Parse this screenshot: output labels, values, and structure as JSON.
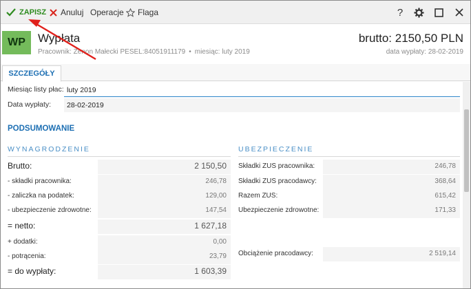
{
  "toolbar": {
    "save_label": "ZAPISZ",
    "cancel_label": "Anuluj",
    "operations_label": "Operacje",
    "flag_label": "Flaga",
    "help_label": "?"
  },
  "header": {
    "avatar": "WP",
    "title": "Wypłata",
    "employee": "Pracownik: Zenon Małecki PESEL:84051911179",
    "separator": "•",
    "month": "miesiąc: luty 2019",
    "brutto": "brutto: 2150,50 PLN",
    "pay_date": "data wypłaty: 28-02-2019"
  },
  "tab": {
    "label": "SZCZEGÓŁY"
  },
  "form": {
    "month_label": "Miesiąc listy płac:",
    "month_value": "luty 2019",
    "date_label": "Data wypłaty:",
    "date_value": "28-02-2019"
  },
  "summary": {
    "title": "PODSUMOWANIE",
    "left_heading": "WYNAGRODZENIE",
    "right_heading": "UBEZPIECZENIE",
    "left": [
      {
        "label": "Brutto:",
        "value": "2 150,50",
        "big": true
      },
      {
        "label": "- składki pracownika:",
        "value": "246,78",
        "big": false
      },
      {
        "label": "- zaliczka na podatek:",
        "value": "129,00",
        "big": false
      },
      {
        "label": "- ubezpieczenie zdrowotne:",
        "value": "147,54",
        "big": false
      },
      {
        "label": "= netto:",
        "value": "1 627,18",
        "big": true
      },
      {
        "label": "+ dodatki:",
        "value": "0,00",
        "big": false
      },
      {
        "label": "- potrącenia:",
        "value": "23,79",
        "big": false
      },
      {
        "label": "= do wypłaty:",
        "value": "1 603,39",
        "big": true
      }
    ],
    "right": [
      {
        "label": "Składki ZUS pracownika:",
        "value": "246,78"
      },
      {
        "label": "Składki ZUS pracodawcy:",
        "value": "368,64"
      },
      {
        "label": "Razem ZUS:",
        "value": "615,42"
      },
      {
        "label": "Ubezpieczenie zdrowotne:",
        "value": "171,33"
      },
      {
        "label": "Obciążenie pracodawcy:",
        "value": "2 519,14"
      }
    ]
  },
  "colors": {
    "accent": "#1d6fb3",
    "save_green": "#2e8b1f",
    "cancel_red": "#d9251c",
    "avatar_green": "#74bb5b",
    "annotation_arrow": "#e0201b"
  }
}
